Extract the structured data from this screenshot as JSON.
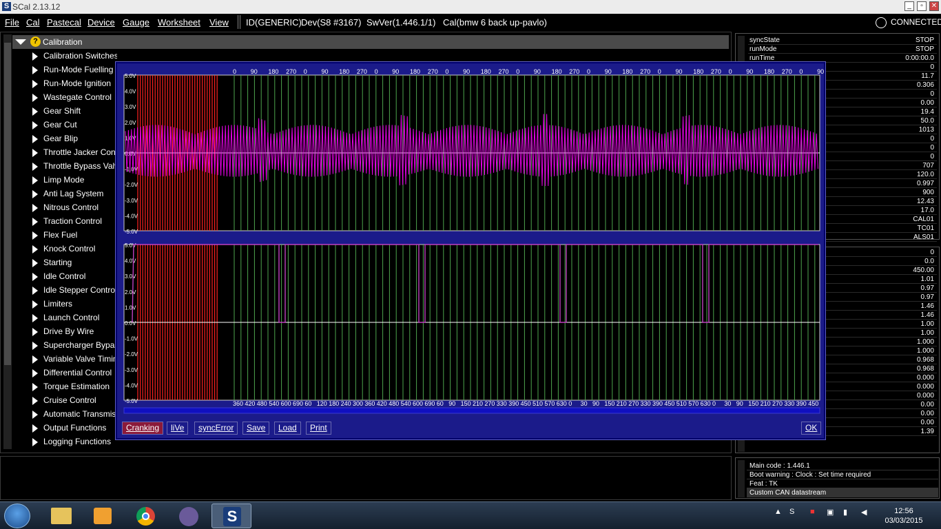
{
  "app": {
    "title": "SCal 2.13.12"
  },
  "menu": [
    "File",
    "Cal",
    "Pastecal",
    "Device",
    "Gauge",
    "Worksheet",
    "View"
  ],
  "info": {
    "id": "ID(GENERIC)",
    "dev": "Dev(S8 #3167)",
    "swver": "SwVer(1.446.1/1)",
    "cal": "Cal(bmw 6 back up-pavlo)"
  },
  "connection": {
    "status": "CONNECTED"
  },
  "tree": {
    "root": "Calibration",
    "items": [
      "Calibration Switches",
      "Run-Mode Fuelling",
      "Run-Mode Ignition",
      "Wastegate Control",
      "Gear Shift",
      "Gear Cut",
      "Gear Blip",
      "Throttle Jacker Control",
      "Throttle Bypass Valve",
      "Limp Mode",
      "Anti Lag System",
      "Nitrous Control",
      "Traction Control",
      "Flex Fuel",
      "Knock Control",
      "Starting",
      "Idle Control",
      "Idle Stepper Control",
      "Limiters",
      "Launch Control",
      "Drive By Wire",
      "Supercharger Bypass",
      "Variable Valve Timing",
      "Differential Control",
      "Torque Estimation",
      "Cruise Control",
      "Automatic Transmission",
      "Output Functions",
      "Logging Functions"
    ]
  },
  "live_panel": {
    "rows": [
      {
        "k": "syncState",
        "v": "STOP"
      },
      {
        "k": "runMode",
        "v": "STOP"
      },
      {
        "k": "runTime",
        "v": "0:00:00.0"
      },
      {
        "k": "",
        "v": "0"
      },
      {
        "k": "",
        "v": "11.7"
      },
      {
        "k": "",
        "v": "0.306"
      },
      {
        "k": "",
        "v": "0"
      },
      {
        "k": "",
        "v": "0.00"
      },
      {
        "k": "",
        "v": "19.4"
      },
      {
        "k": "",
        "v": "50.0"
      },
      {
        "k": "",
        "v": "1013"
      },
      {
        "k": "",
        "v": "0"
      },
      {
        "k": "",
        "v": "0"
      },
      {
        "k": "",
        "v": "0"
      },
      {
        "k": "",
        "v": "707"
      },
      {
        "k": "",
        "v": "120.0"
      },
      {
        "k": "",
        "v": "0.997"
      },
      {
        "k": "",
        "v": "900"
      },
      {
        "k": "",
        "v": "12.43"
      },
      {
        "k": "",
        "v": "17.0"
      },
      {
        "k": "",
        "v": "CAL01"
      },
      {
        "k": "",
        "v": "TC01"
      },
      {
        "k": "",
        "v": "ALS01"
      }
    ]
  },
  "live_panel2": {
    "rows": [
      "0",
      "0.0",
      "450.00",
      "1.01",
      "0.97",
      "0.97",
      "1.46",
      "1.46",
      "1.00",
      "1.00",
      "1.000",
      "1.000",
      "0.968",
      "0.968",
      "0.000",
      "0.000",
      "0.000",
      "0.00",
      "0.00",
      "0.00",
      "1.39"
    ]
  },
  "status_messages": [
    "Main code : 1.446.1",
    "Boot warning : Clock : Set time required",
    "Feat : TK",
    "Custom CAN datastream"
  ],
  "dialog": {
    "buttons": [
      "Cranking",
      "liVe",
      "syncError",
      "Save",
      "Load",
      "Print"
    ],
    "ok": "OK"
  },
  "chart_data": [
    {
      "type": "line",
      "title": "",
      "yticks": [
        "5.0V",
        "4.0V",
        "3.0V",
        "2.0V",
        "1.0V",
        "0.0V",
        "-1.0V",
        "-2.0V",
        "-3.0V",
        "-4.0V",
        "-5.0V"
      ],
      "xticks_top": [
        "0",
        "90",
        "180",
        "270",
        "0",
        "90",
        "180",
        "270",
        "0",
        "90",
        "180",
        "270",
        "0",
        "90",
        "180",
        "270",
        "0",
        "90",
        "180",
        "270",
        "0",
        "90",
        "180",
        "270",
        "0",
        "90",
        "180",
        "270",
        "0",
        "90",
        "180",
        "270",
        "0",
        "90",
        "180",
        "270",
        "0",
        "90"
      ],
      "ylim": [
        -5,
        5
      ],
      "series": [
        {
          "color": "#e800e8",
          "description_values": "oscillating signal approx -1.8V to 1.8V in bursts"
        }
      ]
    },
    {
      "type": "line",
      "title": "",
      "yticks": [
        "5.0V",
        "4.0V",
        "3.0V",
        "2.0V",
        "1.0V",
        "0.0V",
        "-1.0V",
        "-2.0V",
        "-3.0V",
        "-4.0V",
        "-5.0V"
      ],
      "xticks_bottom": [
        "360",
        "420",
        "480",
        "540",
        "600",
        "690",
        "60",
        "120",
        "180",
        "240",
        "300",
        "360",
        "420",
        "480",
        "540",
        "600",
        "690",
        "60",
        "90",
        "150",
        "210",
        "270",
        "330",
        "390",
        "450",
        "510",
        "570",
        "630",
        "0",
        "30",
        "90",
        "150",
        "210",
        "270",
        "330",
        "390",
        "450",
        "510",
        "570",
        "630",
        "0",
        "30",
        "90",
        "150",
        "210",
        "270",
        "330",
        "390",
        "450"
      ],
      "ylim": [
        -5,
        5
      ],
      "series": [
        {
          "color": "#c040c0",
          "values_high": 5.0,
          "values_low": 0.0
        }
      ]
    }
  ],
  "taskbar": {
    "time": "12:56",
    "date": "03/03/2015"
  }
}
